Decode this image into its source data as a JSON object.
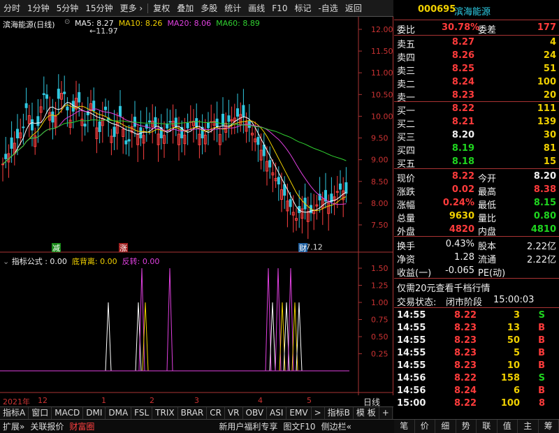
{
  "toolbar": {
    "items": [
      "分时",
      "1分钟",
      "5分钟",
      "15分钟",
      "更多 ›",
      "复权",
      "叠加",
      "多股",
      "统计",
      "画线",
      "F10",
      "标记",
      "-自选",
      "返回"
    ]
  },
  "chart": {
    "title": "滨海能源(日线)",
    "ma5": "MA5: 8.27",
    "ma10": "MA10: 8.26",
    "ma20": "MA20: 8.06",
    "ma60": "MA60: 8.89",
    "high_label": "11.97",
    "low_label": "7.12",
    "y_ticks": [
      "12.00",
      "11.50",
      "11.00",
      "10.50",
      "10.00",
      "9.50",
      "9.00",
      "8.50",
      "8.00",
      "7.50"
    ],
    "marker_jian": "减",
    "marker_zhang": "涨",
    "marker_cai": "财",
    "indicator_name": "指标公式 : 0.00",
    "indicator_dbl": "底背离: 0.00",
    "indicator_fz": "反转: 0.00",
    "ind_ticks": [
      "1.50",
      "1.25",
      "1.00",
      "0.75",
      "0.50",
      "0.25"
    ],
    "date_labels": [
      "2021年",
      "12",
      "1",
      "2",
      "3",
      "4",
      "5"
    ],
    "period": "日线",
    "colors": {
      "ma5": "#ffffff",
      "ma10": "#f0d000",
      "ma20": "#e040e0",
      "ma60": "#30d030",
      "up": "#ff4040",
      "down": "#30c8e0"
    }
  },
  "tabs": [
    "指标A",
    "窗口",
    "MACD",
    "DMI",
    "DMA",
    "FSL",
    "TRIX",
    "BRAR",
    "CR",
    "VR",
    "OBV",
    "ASI",
    "EMV",
    ">",
    "指标B",
    "模 板",
    "+",
    "-"
  ],
  "statusbar": [
    "扩展»",
    "关联报价",
    "财富圈",
    "新用户福利专享",
    "图文F10",
    "侧边栏«"
  ],
  "right_tabs": [
    "笔",
    "价",
    "细",
    "势",
    "联",
    "值",
    "主",
    "筹"
  ],
  "quote": {
    "code": "000695",
    "name": "滨海能源",
    "weibi_label": "委比",
    "weibi": "30.78%",
    "weicha_label": "委差",
    "weicha": "177",
    "asks": [
      {
        "label": "卖五",
        "price": "8.27",
        "vol": "4"
      },
      {
        "label": "卖四",
        "price": "8.26",
        "vol": "24"
      },
      {
        "label": "卖三",
        "price": "8.25",
        "vol": "51"
      },
      {
        "label": "卖二",
        "price": "8.24",
        "vol": "100"
      },
      {
        "label": "卖一",
        "price": "8.23",
        "vol": "20"
      }
    ],
    "bids": [
      {
        "label": "买一",
        "price": "8.22",
        "vol": "111",
        "cls": "red"
      },
      {
        "label": "买二",
        "price": "8.21",
        "vol": "139",
        "cls": "red"
      },
      {
        "label": "买三",
        "price": "8.20",
        "vol": "30",
        "cls": "white"
      },
      {
        "label": "买四",
        "price": "8.19",
        "vol": "81",
        "cls": "green"
      },
      {
        "label": "买五",
        "price": "8.18",
        "vol": "15",
        "cls": "green"
      }
    ],
    "stats": [
      {
        "l1": "现价",
        "v1": "8.22",
        "c1": "red",
        "l2": "今开",
        "v2": "8.20",
        "c2": "white"
      },
      {
        "l1": "涨跌",
        "v1": "0.02",
        "c1": "red",
        "l2": "最高",
        "v2": "8.38",
        "c2": "red"
      },
      {
        "l1": "涨幅",
        "v1": "0.24%",
        "c1": "red",
        "l2": "最低",
        "v2": "8.15",
        "c2": "green"
      },
      {
        "l1": "总量",
        "v1": "9630",
        "c1": "yellow",
        "l2": "量比",
        "v2": "0.80",
        "c2": "green"
      },
      {
        "l1": "外盘",
        "v1": "4820",
        "c1": "red",
        "l2": "内盘",
        "v2": "4810",
        "c2": "green"
      }
    ],
    "stats2": [
      {
        "l1": "换手",
        "v1": "0.43%",
        "l2": "股本",
        "v2": "2.22亿"
      },
      {
        "l1": "净资",
        "v1": "1.28",
        "l2": "流通",
        "v2": "2.22亿"
      },
      {
        "l1": "收益(一)",
        "v1": "-0.065",
        "l2": "PE(动)",
        "v2": ""
      }
    ],
    "promo": "仅需20元查看千档行情",
    "trade_status_label": "交易状态:",
    "trade_status": "闭市阶段",
    "trade_time": "15:00:03",
    "ticks": [
      {
        "t": "14:55",
        "p": "8.22",
        "v": "3",
        "d": "S"
      },
      {
        "t": "14:55",
        "p": "8.23",
        "v": "13",
        "d": "B"
      },
      {
        "t": "14:55",
        "p": "8.23",
        "v": "50",
        "d": "B"
      },
      {
        "t": "14:55",
        "p": "8.23",
        "v": "5",
        "d": "B"
      },
      {
        "t": "14:55",
        "p": "8.23",
        "v": "10",
        "d": "B"
      },
      {
        "t": "14:56",
        "p": "8.22",
        "v": "158",
        "d": "S"
      },
      {
        "t": "14:56",
        "p": "8.24",
        "v": "6",
        "d": "B"
      },
      {
        "t": "15:00",
        "p": "8.22",
        "v": "100",
        "d": "8"
      }
    ]
  }
}
